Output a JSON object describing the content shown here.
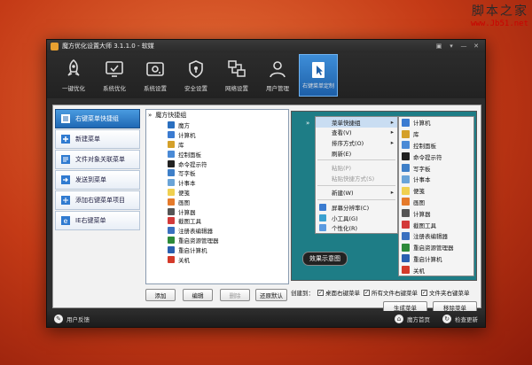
{
  "watermark": {
    "line1": "脚本之家",
    "line2": "www.Jb51.net"
  },
  "window": {
    "title": "魔方优化设置大师 3.1.1.0 - 软媒"
  },
  "toolbar": {
    "items": [
      {
        "label": "一键优化",
        "icon": "rocket-icon"
      },
      {
        "label": "系统优化",
        "icon": "monitor-check-icon"
      },
      {
        "label": "系统设置",
        "icon": "drive-icon"
      },
      {
        "label": "安全设置",
        "icon": "shield-icon"
      },
      {
        "label": "网络设置",
        "icon": "network-icon"
      },
      {
        "label": "用户管理",
        "icon": "user-icon"
      },
      {
        "label": "右键菜单定制",
        "icon": "cursor-icon"
      }
    ]
  },
  "sidebar": {
    "items": [
      {
        "label": "右键菜单快捷组"
      },
      {
        "label": "新建菜单"
      },
      {
        "label": "文件对象关联菜单"
      },
      {
        "label": "发送到菜单"
      },
      {
        "label": "添加右键菜单项目"
      },
      {
        "label": "IE右键菜单"
      }
    ]
  },
  "tree": {
    "root": "魔方快捷组",
    "items": [
      {
        "label": "魔方",
        "color": "#2a6fc0"
      },
      {
        "label": "计算机",
        "color": "#3b7bd1"
      },
      {
        "label": "库",
        "color": "#d4a02a"
      },
      {
        "label": "控制面板",
        "color": "#4a8ad6"
      },
      {
        "label": "命令提示符",
        "color": "#222222"
      },
      {
        "label": "写字板",
        "color": "#3e7fc8"
      },
      {
        "label": "计事本",
        "color": "#6aa4d8"
      },
      {
        "label": "便笺",
        "color": "#f0d050"
      },
      {
        "label": "画图",
        "color": "#e57a2b"
      },
      {
        "label": "计算器",
        "color": "#555555"
      },
      {
        "label": "截图工具",
        "color": "#d33a3a"
      },
      {
        "label": "注册表编辑器",
        "color": "#3a70c0"
      },
      {
        "label": "重启资源管理器",
        "color": "#2d8a3a"
      },
      {
        "label": "重启计算机",
        "color": "#2a5fb0"
      },
      {
        "label": "关机",
        "color": "#d43a2a"
      }
    ]
  },
  "buttons": {
    "add": "添加",
    "edit": "编辑",
    "delete": "删除",
    "restore": "还原默认",
    "generate": "生成菜单",
    "remove": "移除菜单"
  },
  "context_menu": {
    "items": [
      {
        "label": "菜单快捷组",
        "arrow": "▸",
        "highlight": true,
        "icon_color": ""
      },
      {
        "label": "查看(V)",
        "arrow": "▸",
        "icon_color": ""
      },
      {
        "label": "排序方式(O)",
        "arrow": "▸",
        "icon_color": ""
      },
      {
        "label": "刷新(E)",
        "arrow": "",
        "icon_color": ""
      },
      {
        "sep": true
      },
      {
        "label": "粘贴(P)",
        "arrow": "",
        "dim": true,
        "icon_color": ""
      },
      {
        "label": "粘贴快捷方式(S)",
        "arrow": "",
        "dim": true,
        "icon_color": ""
      },
      {
        "sep": true
      },
      {
        "label": "新建(W)",
        "arrow": "▸",
        "icon_color": ""
      },
      {
        "sep": true
      },
      {
        "label": "屏幕分辨率(C)",
        "arrow": "",
        "icon_color": "#3a7bd0"
      },
      {
        "label": "小工具(G)",
        "arrow": "",
        "icon_color": "#3aa0d0"
      },
      {
        "label": "个性化(R)",
        "arrow": "",
        "icon_color": "#5a9ae0"
      }
    ]
  },
  "submenu": {
    "items": [
      {
        "label": "计算机",
        "color": "#3b7bd1"
      },
      {
        "label": "库",
        "color": "#d4a02a"
      },
      {
        "label": "控制面板",
        "color": "#4a8ad6"
      },
      {
        "label": "命令提示符",
        "color": "#222222"
      },
      {
        "label": "写字板",
        "color": "#3e7fc8"
      },
      {
        "label": "计事本",
        "color": "#6aa4d8"
      },
      {
        "label": "便笺",
        "color": "#f0d050"
      },
      {
        "label": "画图",
        "color": "#e57a2b"
      },
      {
        "label": "计算器",
        "color": "#555555"
      },
      {
        "label": "截图工具",
        "color": "#d33a3a"
      },
      {
        "label": "注册表编辑器",
        "color": "#3a70c0"
      },
      {
        "label": "重启资源管理器",
        "color": "#2d8a3a"
      },
      {
        "label": "重启计算机",
        "color": "#2a5fb0"
      },
      {
        "label": "关机",
        "color": "#d43a2a"
      }
    ]
  },
  "preview": {
    "caption": "效果示意图"
  },
  "create": {
    "prefix": "创建到：",
    "options": [
      {
        "label": "桌面右键菜单",
        "checked": true
      },
      {
        "label": "所有文件右键菜单",
        "checked": true
      },
      {
        "label": "文件夹右键菜单",
        "checked": true
      }
    ]
  },
  "statusbar": {
    "left": "用户反馈",
    "right1": "魔方首页",
    "right2": "检查更新"
  },
  "colors": {
    "accent": "#1f68b4",
    "preview_bg": "#1e7d86"
  }
}
